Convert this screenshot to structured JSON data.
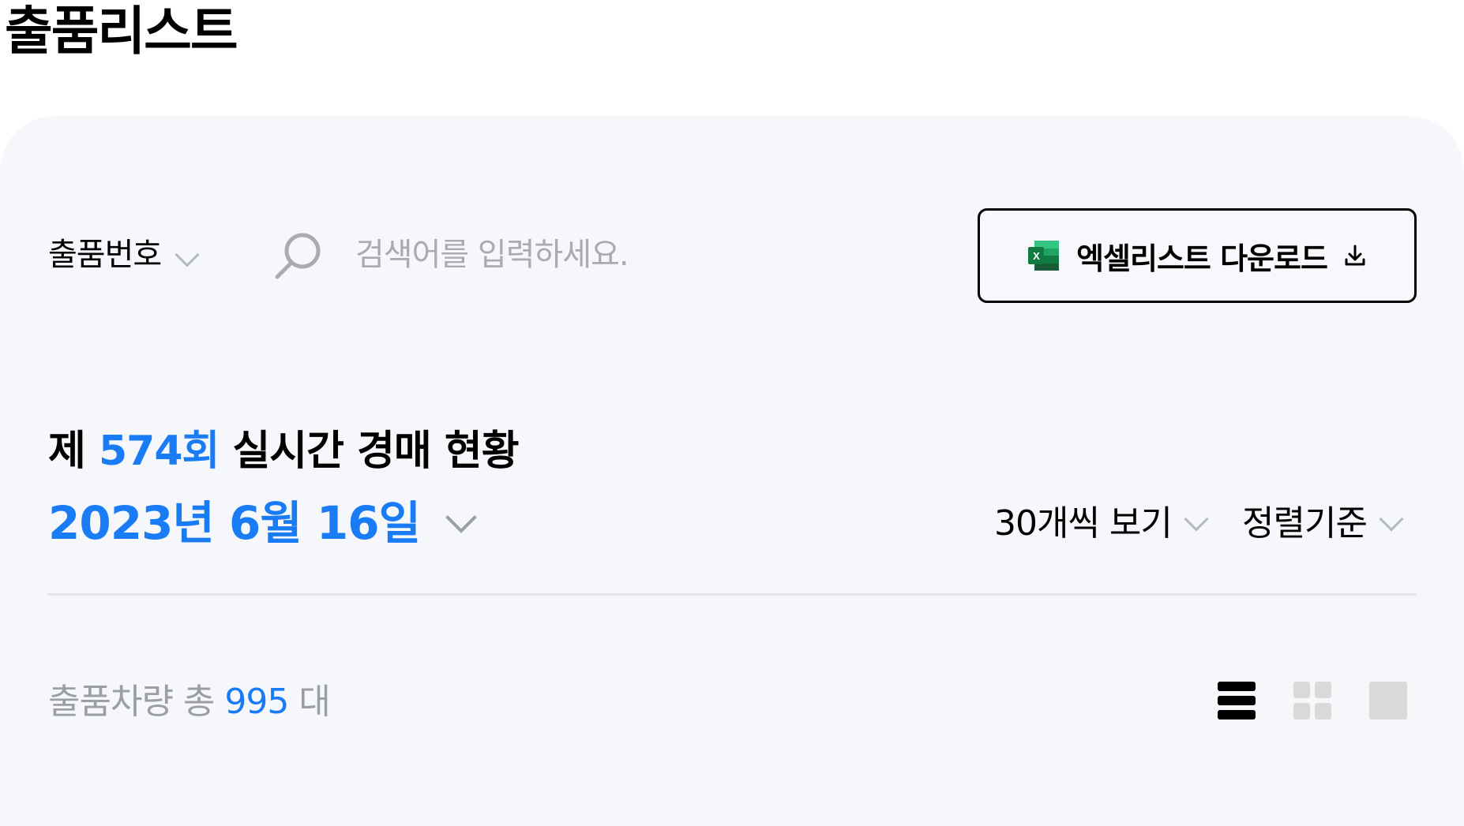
{
  "page_title": "출품리스트",
  "search": {
    "field_select": "출품번호",
    "placeholder": "검색어를 입력하세요.",
    "value": ""
  },
  "excel_button": {
    "label": "엑셀리스트 다운로드"
  },
  "auction": {
    "prefix": "제",
    "round": "574회",
    "suffix": "실시간 경매 현황",
    "date": "2023년 6월 16일"
  },
  "controls": {
    "per_page": "30개씩 보기",
    "sort": "정렬기준"
  },
  "count": {
    "label": "출품차량 총",
    "value": "995",
    "unit": "대"
  },
  "colors": {
    "accent": "#1a7cf5",
    "panel": "#f5f7fb"
  }
}
